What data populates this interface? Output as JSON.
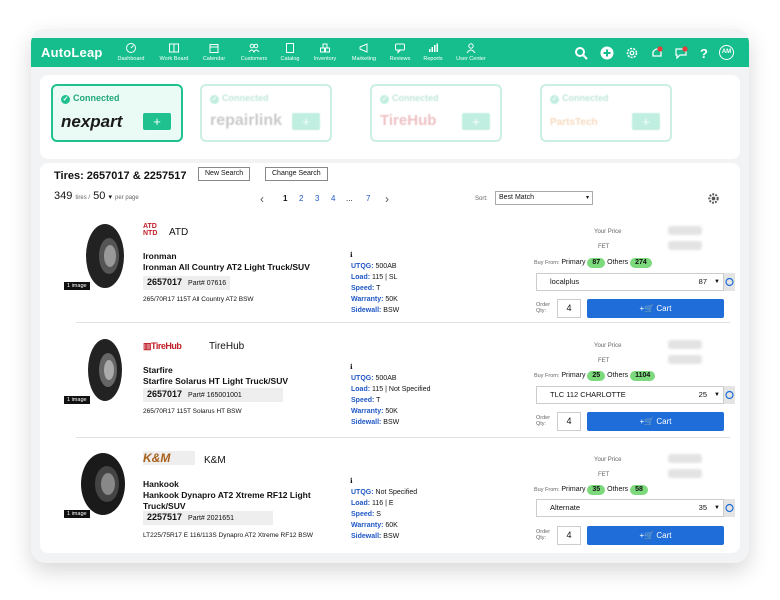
{
  "app": {
    "brand": "AutoLeap"
  },
  "nav": [
    {
      "label": "Dashboard",
      "icon": "dashboard-icon"
    },
    {
      "label": "Work Board",
      "icon": "workboard-icon"
    },
    {
      "label": "Calendar",
      "icon": "calendar-icon"
    },
    {
      "label": "Customers",
      "icon": "customers-icon"
    },
    {
      "label": "Catalog",
      "icon": "catalog-icon"
    },
    {
      "label": "Inventory",
      "icon": "inventory-icon"
    },
    {
      "label": "Marketing",
      "icon": "marketing-icon"
    },
    {
      "label": "Reviews",
      "icon": "reviews-icon"
    },
    {
      "label": "Reports",
      "icon": "reports-icon"
    },
    {
      "label": "User Center",
      "icon": "user-center-icon"
    }
  ],
  "header_right": {
    "notification_badge": "1",
    "message_badge": "11",
    "avatar": "AM"
  },
  "connectors": [
    {
      "status": "Connected",
      "name": "nexpart",
      "add": "+"
    },
    {
      "status": "Connected",
      "name": "repairlink",
      "add": "+"
    },
    {
      "status": "Connected",
      "name": "TireHub",
      "add": "+"
    },
    {
      "status": "Connected",
      "name": "PartsTech",
      "add": "+"
    }
  ],
  "search": {
    "title": "Tires: 2657017 & 2257517",
    "new_search": "New Search",
    "change_search": "Change Search",
    "count": "349",
    "count_unit": "tires /",
    "per_page": "50",
    "per_page_unit": "per page",
    "pages": [
      "1",
      "2",
      "3",
      "4",
      "...",
      "7"
    ],
    "sort_label": "Sort:",
    "sort_value": "Best Match"
  },
  "labels": {
    "your_price": "Your Price",
    "fet": "FET",
    "buy_from": "Buy From:",
    "primary": "Primary",
    "others": "Others",
    "order_qty": "Order Qty:",
    "cart": "+🛒 Cart",
    "image": "1 image",
    "part": "Part#",
    "utqg": "UTQG:",
    "load": "Load:",
    "speed": "Speed:",
    "warranty": "Warranty:",
    "sidewall": "Sidewall:"
  },
  "products": [
    {
      "distributor": "ATD",
      "brand": "Ironman",
      "name": "Ironman All Country AT2 Light Truck/SUV",
      "number": "2657017",
      "part": "07616",
      "size": "265/70R17 115T All Country AT2 BSW",
      "utqg": "500AB",
      "load": "115 | SL",
      "speed": "T",
      "warranty": "50K",
      "sidewall": "BSW",
      "primary": "87",
      "others": "274",
      "supplier": "localplus",
      "supplier_qty": "87",
      "order_qty": "4"
    },
    {
      "distributor": "TireHub",
      "brand": "Starfire",
      "name": "Starfire Solarus HT Light Truck/SUV",
      "number": "2657017",
      "part": "165001001",
      "size": "265/70R17 115T Solarus HT BSW",
      "utqg": "500AB",
      "load": "115 | Not Specified",
      "speed": "T",
      "warranty": "50K",
      "sidewall": "BSW",
      "primary": "25",
      "others": "1104",
      "supplier": "TLC 112 CHARLOTTE",
      "supplier_qty": "25",
      "order_qty": "4"
    },
    {
      "distributor": "K&M",
      "brand": "Hankook",
      "name": "Hankook Dynapro AT2 Xtreme RF12 Light Truck/SUV",
      "number": "2257517",
      "part": "2021651",
      "size": "LT225/75R17 E 116/113S Dynapro AT2 Xtreme RF12 BSW",
      "utqg": "Not Specified",
      "load": "116 | E",
      "speed": "S",
      "warranty": "60K",
      "sidewall": "BSW",
      "primary": "35",
      "others": "58",
      "supplier": "Alternate",
      "supplier_qty": "35",
      "order_qty": "4"
    }
  ],
  "colors": {
    "accent": "#15be8c",
    "blue": "#1f6dd8",
    "pill": "#7cd97c"
  }
}
